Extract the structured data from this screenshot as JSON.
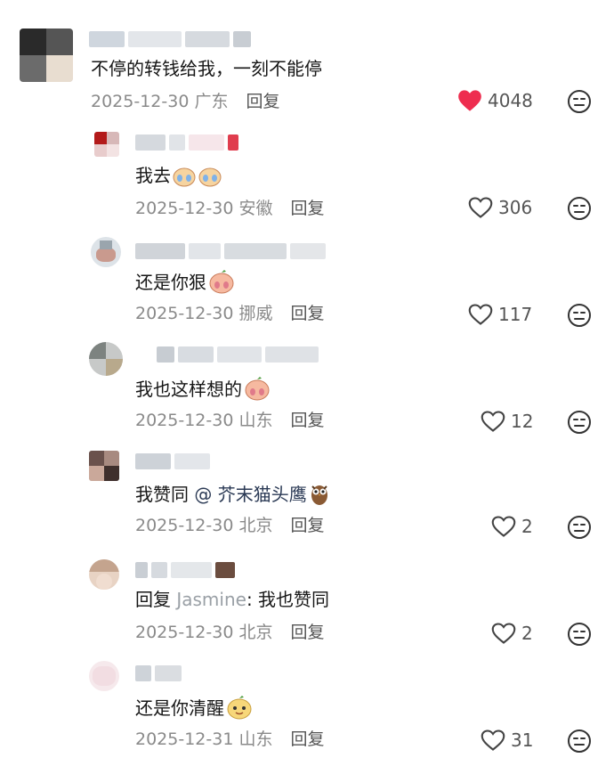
{
  "comments": [
    {
      "text": "不停的转钱给我，一刻不能停",
      "date": "2025-12-30",
      "location": "广东",
      "reply_label": "回复",
      "likes": "4048",
      "liked": true
    },
    {
      "text": "我去",
      "date": "2025-12-30",
      "location": "安徽",
      "reply_label": "回复",
      "likes": "306",
      "liked": false
    },
    {
      "text": "还是你狠",
      "date": "2025-12-30",
      "location": "挪威",
      "reply_label": "回复",
      "likes": "117",
      "liked": false
    },
    {
      "text": "我也这样想的",
      "date": "2025-12-30",
      "location": "山东",
      "reply_label": "回复",
      "likes": "12",
      "liked": false
    },
    {
      "text_prefix": "我赞同 ",
      "mention": "@ 芥末猫头鹰",
      "date": "2025-12-30",
      "location": "北京",
      "reply_label": "回复",
      "likes": "2",
      "liked": false
    },
    {
      "text_prefix": "回复 ",
      "reply_to": "Jasmine",
      "text_suffix": ": 我也赞同",
      "date": "2025-12-30",
      "location": "北京",
      "reply_label": "回复",
      "likes": "2",
      "liked": false
    },
    {
      "text": "还是你清醒",
      "date": "2025-12-31",
      "location": "山东",
      "reply_label": "回复",
      "likes": "31",
      "liked": false
    }
  ],
  "colors": {
    "like_active": "#ee2d4f",
    "meta_gray": "#8a8a8a"
  },
  "icons": {
    "like": "heart-icon",
    "dislike": "dislike-face-icon"
  }
}
